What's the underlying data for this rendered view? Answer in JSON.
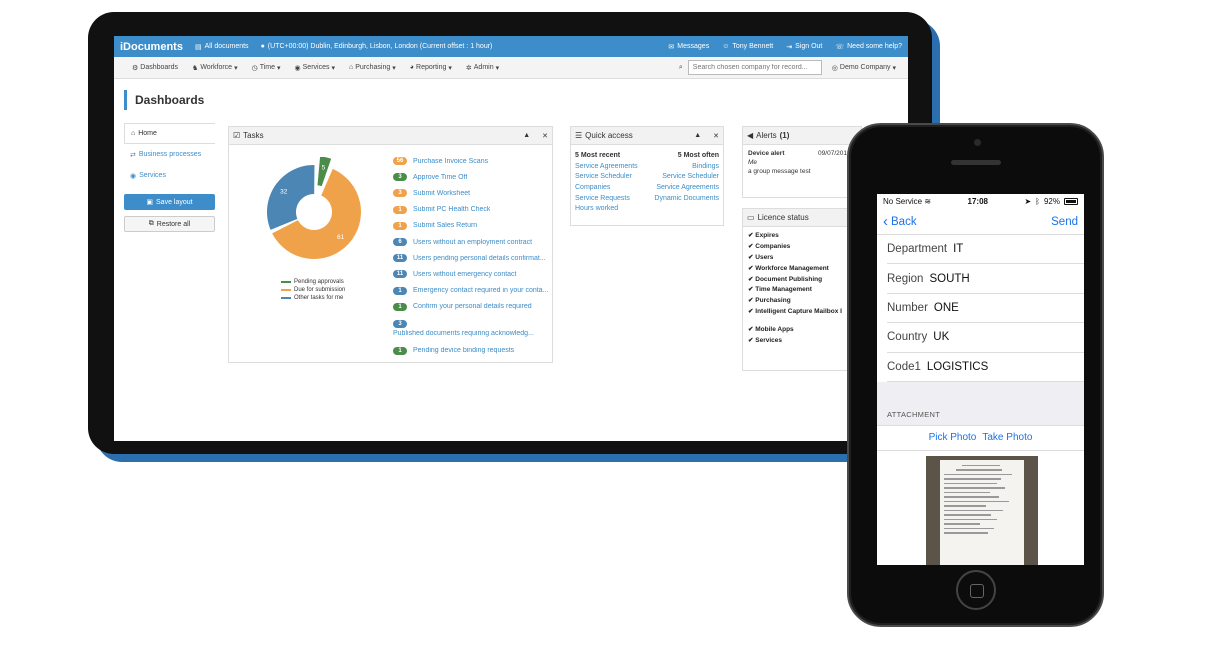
{
  "tablet": {
    "topbar": {
      "logo": "iDocuments",
      "all_documents": "All documents",
      "timezone": "(UTC+00:00) Dublin, Edinburgh, Lisbon, London (Current offset : 1 hour)",
      "messages": "Messages",
      "user": "Tony Bennett",
      "sign_out": "Sign Out",
      "help": "Need some help?"
    },
    "nav": {
      "items": [
        "Dashboards",
        "Workforce",
        "Time",
        "Services",
        "Purchasing",
        "Reporting",
        "Admin"
      ],
      "search_placeholder": "Search chosen company for record...",
      "company": "Demo Company"
    },
    "page_title": "Dashboards",
    "sidebar": {
      "home": "Home",
      "business_processes": "Business processes",
      "services": "Services",
      "save_layout": "Save layout",
      "restore_all": "Restore all"
    },
    "tasks": {
      "title": "Tasks",
      "items": [
        {
          "count": "56",
          "label": "Purchase Invoice Scans",
          "color": "#f0a24a"
        },
        {
          "count": "3",
          "label": "Approve Time Off",
          "color": "#4a8c4a"
        },
        {
          "count": "3",
          "label": "Submit Worksheet",
          "color": "#f0a24a"
        },
        {
          "count": "1",
          "label": "Submit PC Health Check",
          "color": "#f0a24a"
        },
        {
          "count": "1",
          "label": "Submit Sales Return",
          "color": "#f0a24a"
        },
        {
          "count": "6",
          "label": "Users without an employment contract",
          "color": "#4b86b4"
        },
        {
          "count": "11",
          "label": "Users pending personal details confirmat...",
          "color": "#4b86b4"
        },
        {
          "count": "11",
          "label": "Users without emergency contact",
          "color": "#4b86b4"
        },
        {
          "count": "1",
          "label": "Emergency contact required in your conta...",
          "color": "#4b86b4"
        },
        {
          "count": "1",
          "label": "Confirm your personal details required",
          "color": "#4a8c4a"
        },
        {
          "count": "3",
          "label": "Published documents requiring acknowledg...",
          "color": "#4b86b4"
        },
        {
          "count": "1",
          "label": "Pending device binding requests",
          "color": "#4a8c4a"
        }
      ],
      "legend": [
        "Pending approvals",
        "Due for submission",
        "Other tasks for me"
      ]
    },
    "chart_data": {
      "type": "pie",
      "categories": [
        "Pending approvals",
        "Due for submission",
        "Other tasks for me"
      ],
      "values": [
        5,
        61,
        32
      ],
      "colors": [
        "#4a8c4a",
        "#f0a24a",
        "#4b86b4"
      ]
    },
    "quick_access": {
      "title": "Quick access",
      "recent_header": "5 Most recent",
      "often_header": "5 Most often",
      "recent": [
        "Service Agreements",
        "Service Scheduler",
        "Companies",
        "Service Requests",
        "Hours worked"
      ],
      "often": [
        "Bindings",
        "Service Scheduler",
        "Service Agreements",
        "Dynamic Documents"
      ]
    },
    "alerts": {
      "title": "Alerts",
      "count": "(1)",
      "item_title": "Device alert",
      "item_date": "09/07/2019 1",
      "from": "Me",
      "message": "a group message test"
    },
    "licence": {
      "title": "Licence status",
      "items": [
        "Expires",
        "Companies",
        "Users",
        "Workforce Management",
        "Document Publishing",
        "Time Management",
        "Purchasing",
        "Intelligent Capture Mailbox I"
      ],
      "items2": [
        "Mobile Apps",
        "Services"
      ]
    }
  },
  "phone": {
    "status": {
      "carrier": "No Service",
      "time": "17:08",
      "battery": "92%"
    },
    "nav": {
      "back": "Back",
      "send": "Send"
    },
    "fields": [
      {
        "label": "Department",
        "value": "IT"
      },
      {
        "label": "Region",
        "value": "SOUTH"
      },
      {
        "label": "Number",
        "value": "ONE"
      },
      {
        "label": "Country",
        "value": "UK"
      },
      {
        "label": "Code1",
        "value": "LOGISTICS"
      }
    ],
    "attachment_header": "ATTACHMENT",
    "pick_photo": "Pick Photo",
    "take_photo": "Take Photo"
  }
}
